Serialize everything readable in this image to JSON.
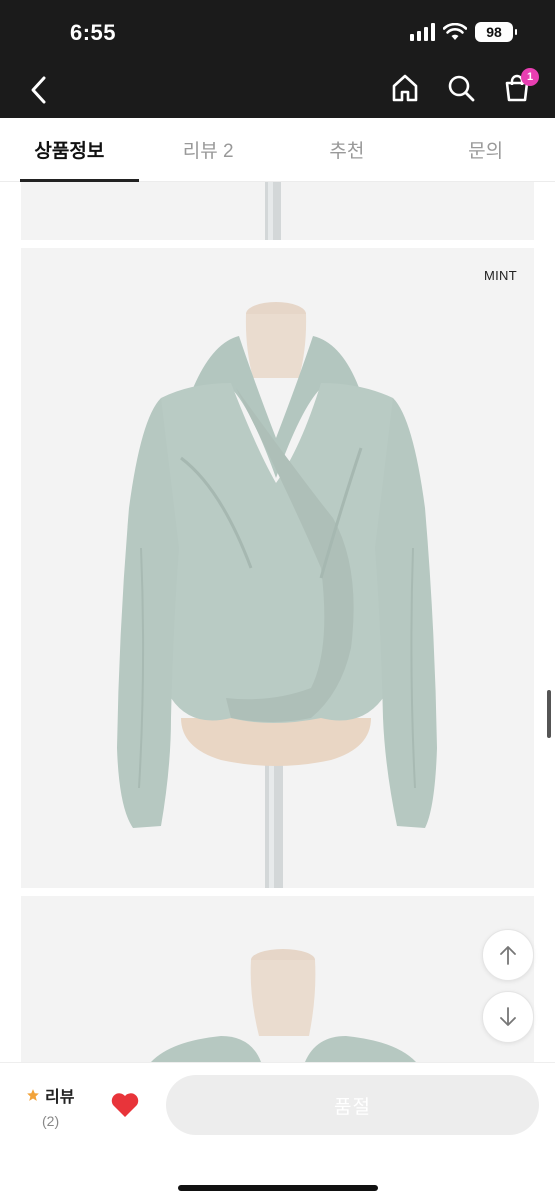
{
  "status_bar": {
    "time": "6:55",
    "battery": "98"
  },
  "header": {
    "back_icon": "chevron-left-icon",
    "home_icon": "home-icon",
    "search_icon": "search-icon",
    "cart_icon": "shopping-bag-icon",
    "cart_badge": "1",
    "colors": {
      "background": "#1b1b1b",
      "badge": "#e83fb2"
    }
  },
  "tabs": [
    {
      "label": "상품정보",
      "active": true
    },
    {
      "label": "리뷰 2",
      "active": false
    },
    {
      "label": "추천",
      "active": false
    },
    {
      "label": "문의",
      "active": false
    }
  ],
  "content": {
    "image_2_label": "MINT",
    "garment_color": "#b7c9c2"
  },
  "scroll_buttons": {
    "up_icon": "arrow-up-icon",
    "down_icon": "arrow-down-icon"
  },
  "bottom_bar": {
    "review_label": "리뷰",
    "review_count": "(2)",
    "star_color": "#f2a33a",
    "heart_color": "#e8343a",
    "action_label": "품절"
  }
}
